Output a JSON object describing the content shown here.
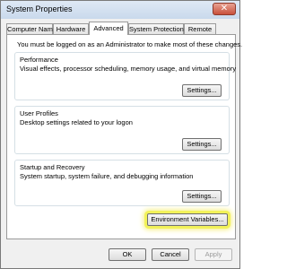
{
  "window": {
    "title": "System Properties",
    "close_glyph": "✕"
  },
  "tabs": [
    {
      "label": "Computer Name",
      "active": false
    },
    {
      "label": "Hardware",
      "active": false
    },
    {
      "label": "Advanced",
      "active": true
    },
    {
      "label": "System Protection",
      "active": false
    },
    {
      "label": "Remote",
      "active": false
    }
  ],
  "advanced": {
    "admin_note": "You must be logged on as an Administrator to make most of these changes.",
    "performance": {
      "title": "Performance",
      "description": "Visual effects, processor scheduling, memory usage, and virtual memory",
      "button": "Settings..."
    },
    "user_profiles": {
      "title": "User Profiles",
      "description": "Desktop settings related to your logon",
      "button": "Settings..."
    },
    "startup_recovery": {
      "title": "Startup and Recovery",
      "description": "System startup, system failure, and debugging information",
      "button": "Settings..."
    },
    "environment_button": "Environment Variables...",
    "highlight_color": "#f2f25a"
  },
  "footer": {
    "ok": "OK",
    "cancel": "Cancel",
    "apply": "Apply"
  }
}
